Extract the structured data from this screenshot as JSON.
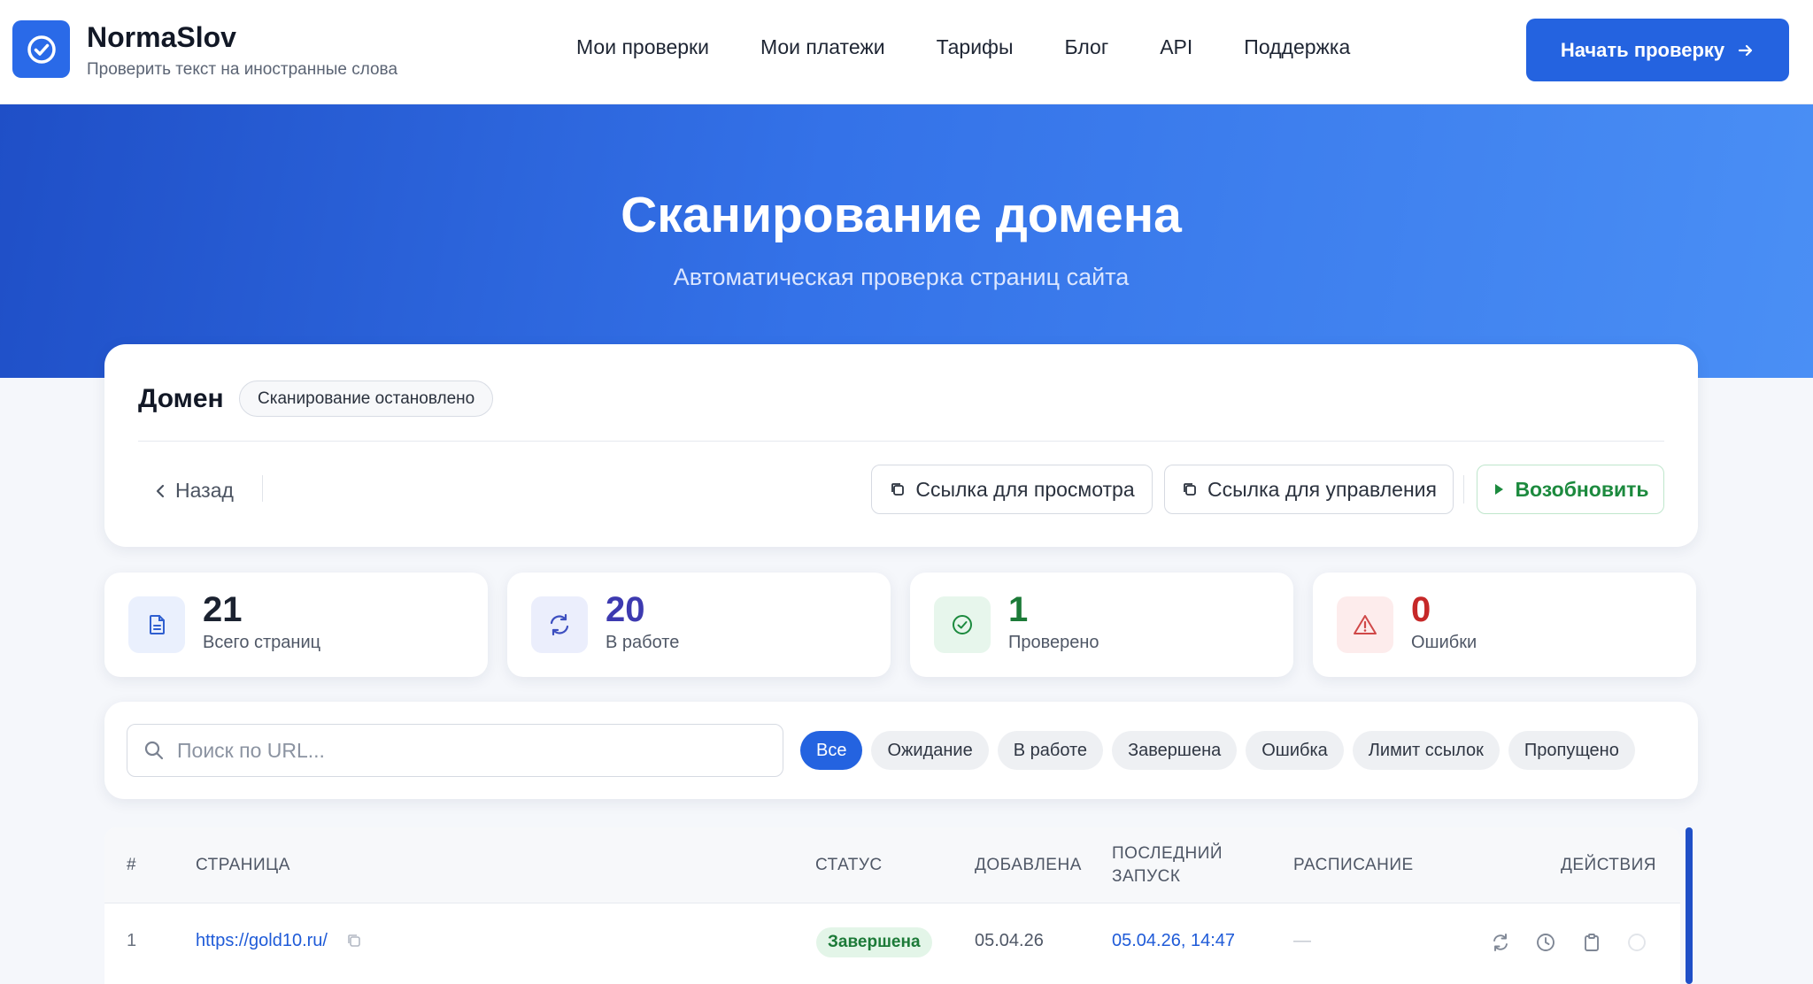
{
  "header": {
    "brand_name": "NormaSlov",
    "brand_subtitle": "Проверить текст на иностранные слова",
    "nav": [
      "Мои проверки",
      "Мои платежи",
      "Тарифы",
      "Блог",
      "API",
      "Поддержка"
    ],
    "cta_label": "Начать проверку"
  },
  "hero": {
    "title": "Сканирование домена",
    "subtitle": "Автоматическая проверка страниц сайта"
  },
  "domain": {
    "title": "Домен",
    "status": "Сканирование остановлено",
    "back_label": "Назад",
    "view_link_label": "Ссылка для просмотра",
    "manage_link_label": "Ссылка для управления",
    "resume_label": "Возобновить"
  },
  "stats": [
    {
      "value": "21",
      "label": "Всего страниц",
      "icon": "document-icon",
      "color": "#1b2230"
    },
    {
      "value": "20",
      "label": "В работе",
      "icon": "refresh-icon",
      "color": "#3d3ab0"
    },
    {
      "value": "1",
      "label": "Проверено",
      "icon": "check-circle-icon",
      "color": "#1c7a38"
    },
    {
      "value": "0",
      "label": "Ошибки",
      "icon": "warning-icon",
      "color": "#c62828"
    }
  ],
  "search": {
    "placeholder": "Поиск по URL...",
    "value": ""
  },
  "filters": [
    "Все",
    "Ожидание",
    "В работе",
    "Завершена",
    "Ошибка",
    "Лимит ссылок",
    "Пропущено"
  ],
  "active_filter": "Все",
  "table": {
    "headers": {
      "num": "#",
      "page": "СТРАНИЦА",
      "status": "СТАТУС",
      "added": "ДОБАВЛЕНА",
      "last_run_1": "ПОСЛЕДНИЙ",
      "last_run_2": "ЗАПУСК",
      "schedule": "РАСПИСАНИЕ",
      "actions": "ДЕЙСТВИЯ"
    },
    "rows": [
      {
        "num": "1",
        "url": "https://gold10.ru/",
        "status": "Завершена",
        "added": "05.04.26",
        "last_run": "05.04.26, 14:47",
        "schedule": "—"
      }
    ]
  },
  "colors": {
    "primary": "#2463e0",
    "success": "#1c8a3e",
    "danger": "#c62828"
  }
}
